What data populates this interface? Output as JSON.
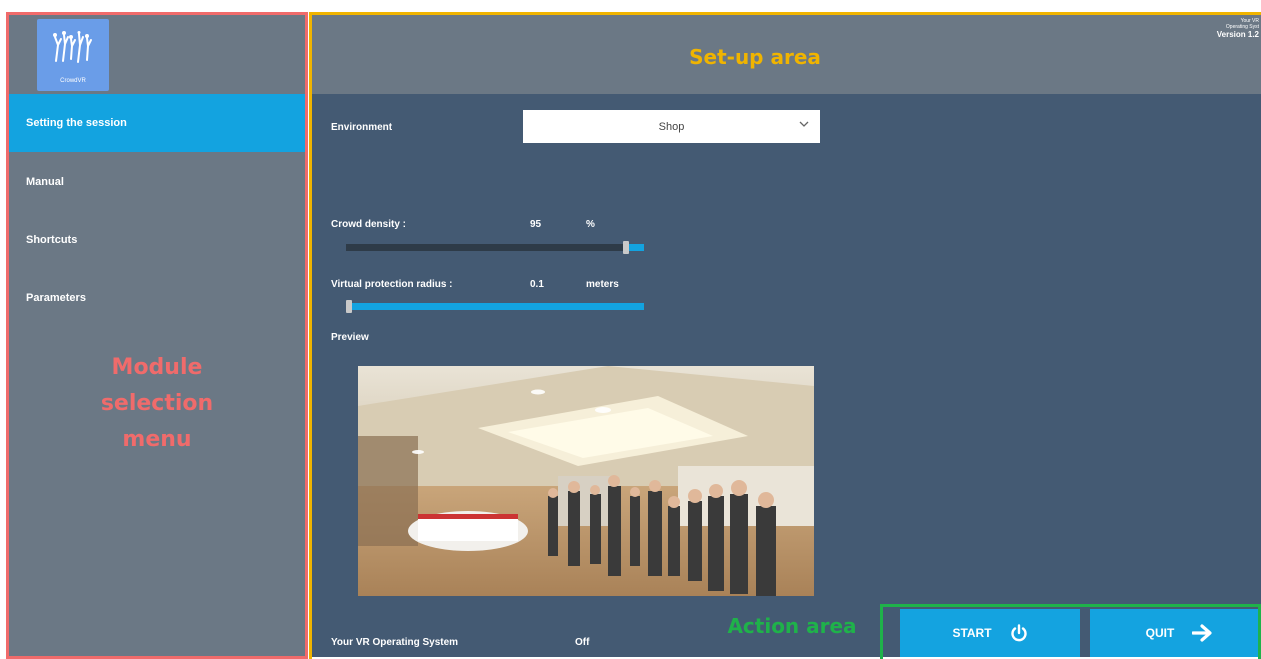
{
  "app": {
    "logo_text": "CrowdVR",
    "version_small_line1": "Your VR",
    "version_small_line2": "Operating Syst",
    "version": "Version 1.2"
  },
  "sidebar": {
    "items": [
      {
        "label": "Setting the session",
        "active": true
      },
      {
        "label": "Manual",
        "active": false
      },
      {
        "label": "Shortcuts",
        "active": false
      },
      {
        "label": "Parameters",
        "active": false
      }
    ]
  },
  "setup": {
    "environment_label": "Environment",
    "environment_value": "Shop",
    "crowd_density_label": "Crowd density :",
    "crowd_density_value": "95",
    "crowd_density_unit": "%",
    "crowd_density_fraction": 0.95,
    "radius_label": "Virtual protection radius :",
    "radius_value": "0.1",
    "radius_unit": "meters",
    "radius_fraction": 0.0,
    "preview_label": "Preview",
    "vr_os_label": "Your VR Operating System",
    "vr_os_value": "Off"
  },
  "actions": {
    "start_label": "START",
    "quit_label": "QUIT"
  },
  "annotations": {
    "module_menu": [
      "Module",
      "selection",
      "menu"
    ],
    "setup_area": "Set-up area",
    "action_area": "Action area"
  },
  "colors": {
    "module_frame": "#f06b6b",
    "setup_frame": "#f0b400",
    "action_frame": "#1fb24a",
    "accent": "#13a3e0"
  },
  "icons": {
    "dropdown": "chevron-down-icon",
    "start": "power-icon",
    "quit": "arrow-right-icon"
  }
}
